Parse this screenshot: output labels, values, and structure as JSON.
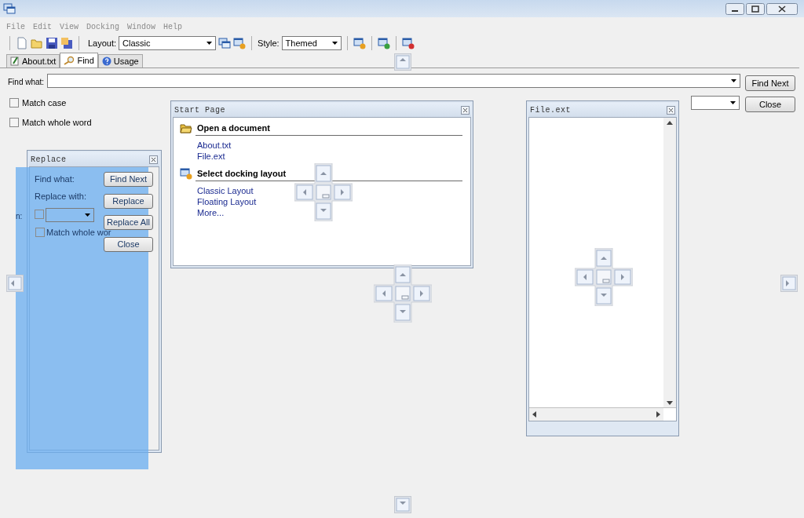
{
  "menu": [
    "File",
    "Edit",
    "View",
    "Docking",
    "Window",
    "Help"
  ],
  "toolbar": {
    "layout_label": "Layout:",
    "layout_value": "Classic",
    "style_label": "Style:",
    "style_value": "Themed"
  },
  "tabs": [
    {
      "label": "About.txt",
      "selected": false
    },
    {
      "label": "Find",
      "selected": true
    },
    {
      "label": "Usage",
      "selected": false
    }
  ],
  "find_panel": {
    "find_label": "Find what:",
    "checkboxes": [
      {
        "label": "Match case",
        "checked": false
      },
      {
        "label": "Match whole word",
        "checked": false
      }
    ],
    "buttons": [
      "Find Next",
      "Close"
    ]
  },
  "replace_window": {
    "title": "Replace",
    "labels": [
      "Find what:",
      "Replace with:"
    ],
    "prefix": "n:",
    "prefix_checkbox": {
      "checked": false
    },
    "checkbox": {
      "label": "Match whole wor",
      "checked": false
    },
    "buttons": [
      "Find Next",
      "Replace",
      "Replace All",
      "Close"
    ]
  },
  "start_page": {
    "title": "Start Page",
    "sections": [
      {
        "heading": "Open a document",
        "links": [
          "About.txt",
          "File.ext"
        ]
      },
      {
        "heading": "Select docking layout",
        "links": [
          "Classic Layout",
          "Floating Layout",
          "More..."
        ]
      }
    ]
  },
  "file_window": {
    "title": "File.ext"
  }
}
